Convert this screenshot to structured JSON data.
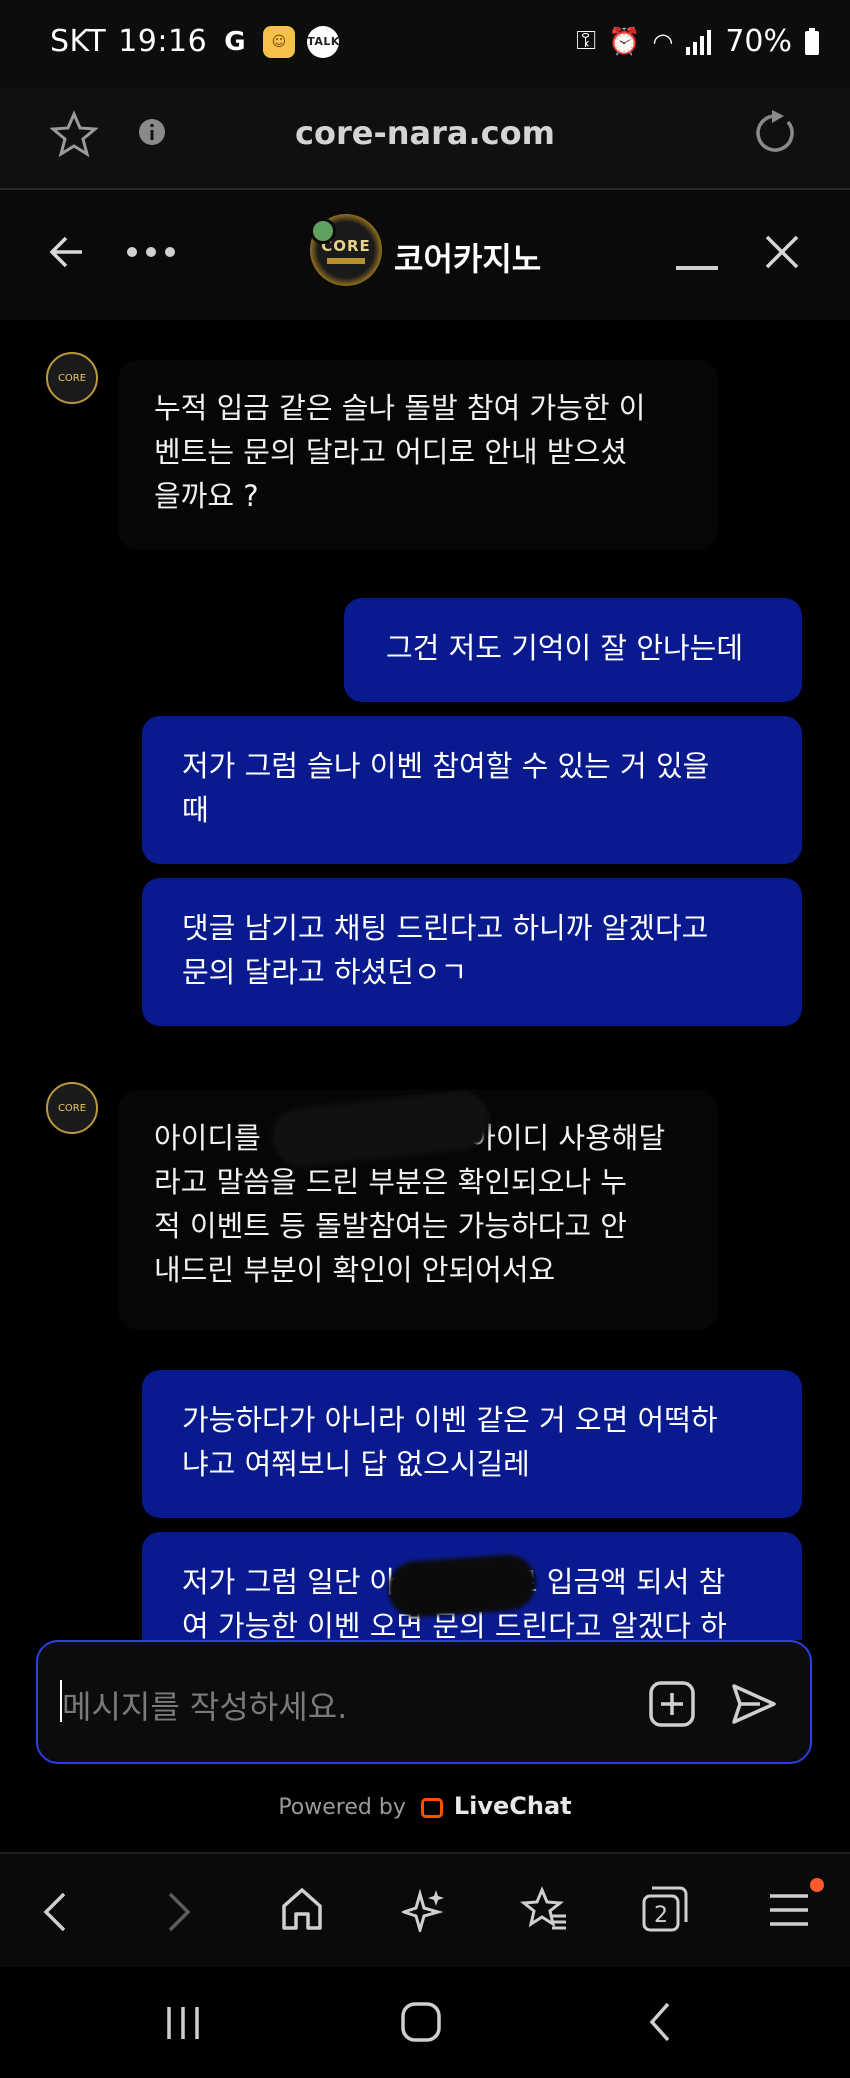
{
  "status_bar": {
    "carrier": "SKT",
    "time": "19:16",
    "battery": "70%"
  },
  "browser": {
    "url": "core-nara.com"
  },
  "chat_header": {
    "title": "코어카지노",
    "logo_text": "CORE"
  },
  "messages": [
    {
      "from": "agent",
      "text": "누적 입금 같은 슬나 돌발 참여 가능한 이 벤트는 문의 달라고 어디로 안내 받으셨 을까요 ?"
    },
    {
      "from": "user",
      "text": "그건 저도 기억이 잘 안나는데"
    },
    {
      "from": "user",
      "text": "저가 그럼 슬나 이벤 참여할 수 있는 거 있을 때"
    },
    {
      "from": "user",
      "text": "댓글 남기고 채팅 드린다고 하니까 알겠다고 문의 달라고 하셨던ㅇㄱ"
    },
    {
      "from": "agent",
      "text": "아이디를 ░░░░░░░░ 아이디 사용해달 라고 말씀을 드린 부분은 확인되오나 누 적 이벤트 등 돌발참여는 가능하다고 안 내드린 부분이 확인이 안되어서요"
    },
    {
      "from": "user",
      "text": "가능하다가 아니라 이벤 같은 거 오면 어떡하 냐고 여쭤보니 답 없으시길레"
    },
    {
      "from": "user",
      "text": "저가 그럼 일단 ░░░░░░로 입금액 되서 참 여 가능한 이벤 오면 문의 드린다고 알겠다 하"
    }
  ],
  "agent_lines": {
    "m1": [
      "누적 입금 같은 슬나 돌발 참여 가능한 이",
      "벤트는 문의 달라고 어디로 안내 받으셨",
      "을까요 ?"
    ],
    "m5": [
      "아이디를",
      "아이디 사용해달",
      "라고 말씀을 드린 부분은 확인되오나 누",
      "적 이벤트 등 돌발참여는 가능하다고 안",
      "내드린 부분이 확인이 안되어서요"
    ]
  },
  "user_lines": {
    "m2": [
      "그건 저도 기억이 잘 안나는데"
    ],
    "m3": [
      "저가 그럼 슬나 이벤 참여할 수 있는 거 있을",
      "때"
    ],
    "m4": [
      "댓글 남기고 채팅 드린다고 하니까 알겠다고",
      "문의 달라고 하셨던ㅇㄱ"
    ],
    "m6": [
      "가능하다가 아니라 이벤 같은 거 오면 어떡하",
      "냐고 여쭤보니 답 없으시길레"
    ],
    "m7a": "저가 그럼 일단 아",
    "m7b": "로 입금액 되서 참",
    "m7c": "여 가능한 이벤 오면 문의 드린다고 알겠다 하"
  },
  "composer": {
    "placeholder": "메시지를 작성하세요."
  },
  "footer": {
    "powered_by": "Powered by",
    "brand": "LiveChat"
  },
  "colors": {
    "user_bubble": "#091a8f",
    "composer_border": "#2a40e0",
    "livechat_orange": "#ff5100"
  }
}
